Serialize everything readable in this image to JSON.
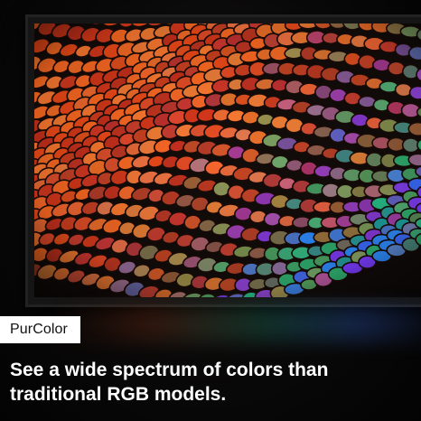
{
  "feature_badge": "PurColor",
  "headline": {
    "line1": "See a wide spectrum of colors than",
    "line2": "traditional RGB models."
  },
  "colors": {
    "background": "#000000",
    "badge_background": "#ffffff",
    "badge_text": "#111111",
    "headline_text": "#ffffff",
    "scale_palette": [
      "#ff5a1f",
      "#e8401a",
      "#c0301a",
      "#2fb070",
      "#1fa0a0",
      "#3b6cff",
      "#7a3cff",
      "#d05030"
    ]
  }
}
